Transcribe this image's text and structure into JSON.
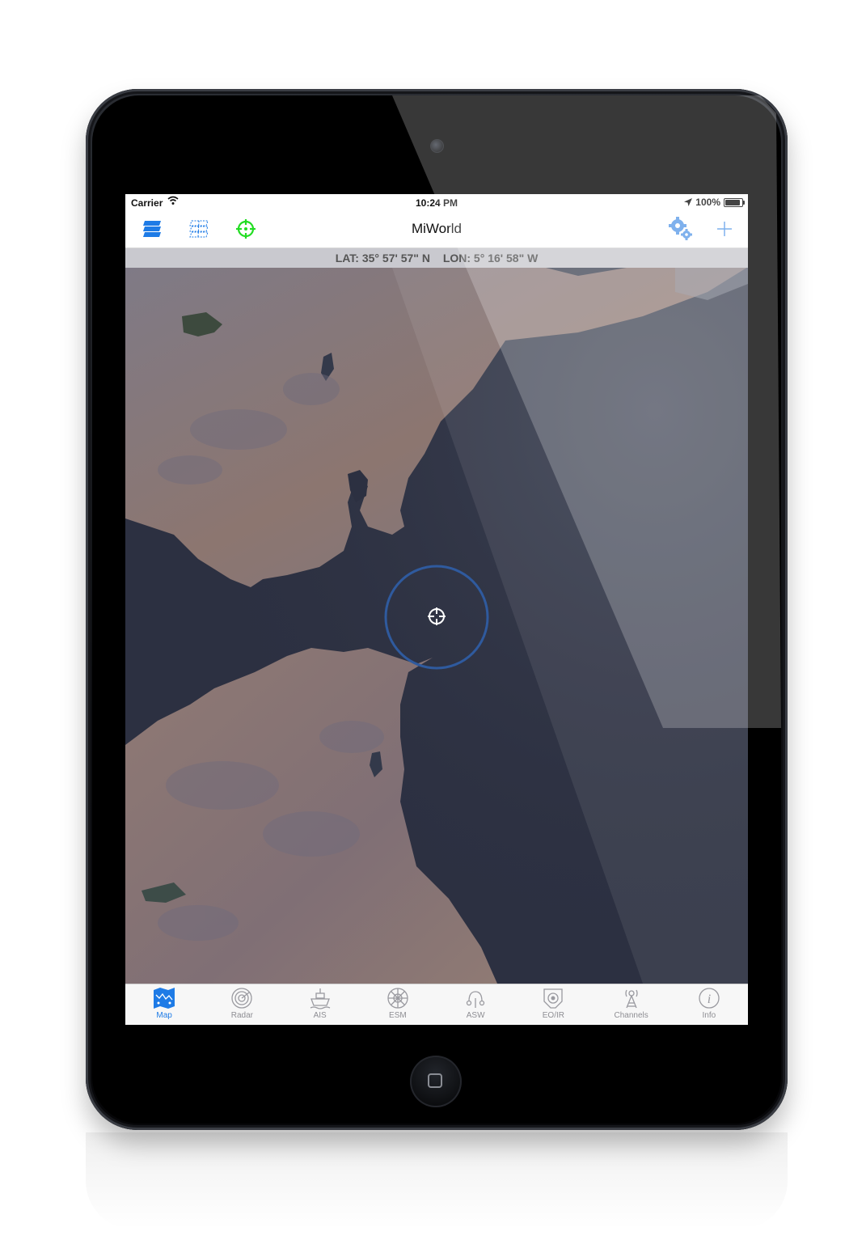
{
  "status_bar": {
    "carrier": "Carrier",
    "time": "10:24 PM",
    "battery": "100%",
    "battery_level": 1.0
  },
  "nav": {
    "title": "MiWorld"
  },
  "coordinates": {
    "lat": "LAT: 35° 57' 57\" N",
    "lon": "LON: 5° 16' 58\" W"
  },
  "tabs": [
    {
      "label": "Map",
      "icon": "map-icon",
      "active": true
    },
    {
      "label": "Radar",
      "icon": "radar-icon",
      "active": false
    },
    {
      "label": "AIS",
      "icon": "ship-icon",
      "active": false
    },
    {
      "label": "ESM",
      "icon": "esm-icon",
      "active": false
    },
    {
      "label": "ASW",
      "icon": "sonar-icon",
      "active": false
    },
    {
      "label": "EO/IR",
      "icon": "camera-icon",
      "active": false
    },
    {
      "label": "Channels",
      "icon": "antenna-icon",
      "active": false
    },
    {
      "label": "Info",
      "icon": "info-icon",
      "active": false
    }
  ],
  "colors": {
    "accent": "#1e7be6",
    "locate": "#22dd22",
    "sea": "#2d3142",
    "land": "#8a7a78"
  }
}
